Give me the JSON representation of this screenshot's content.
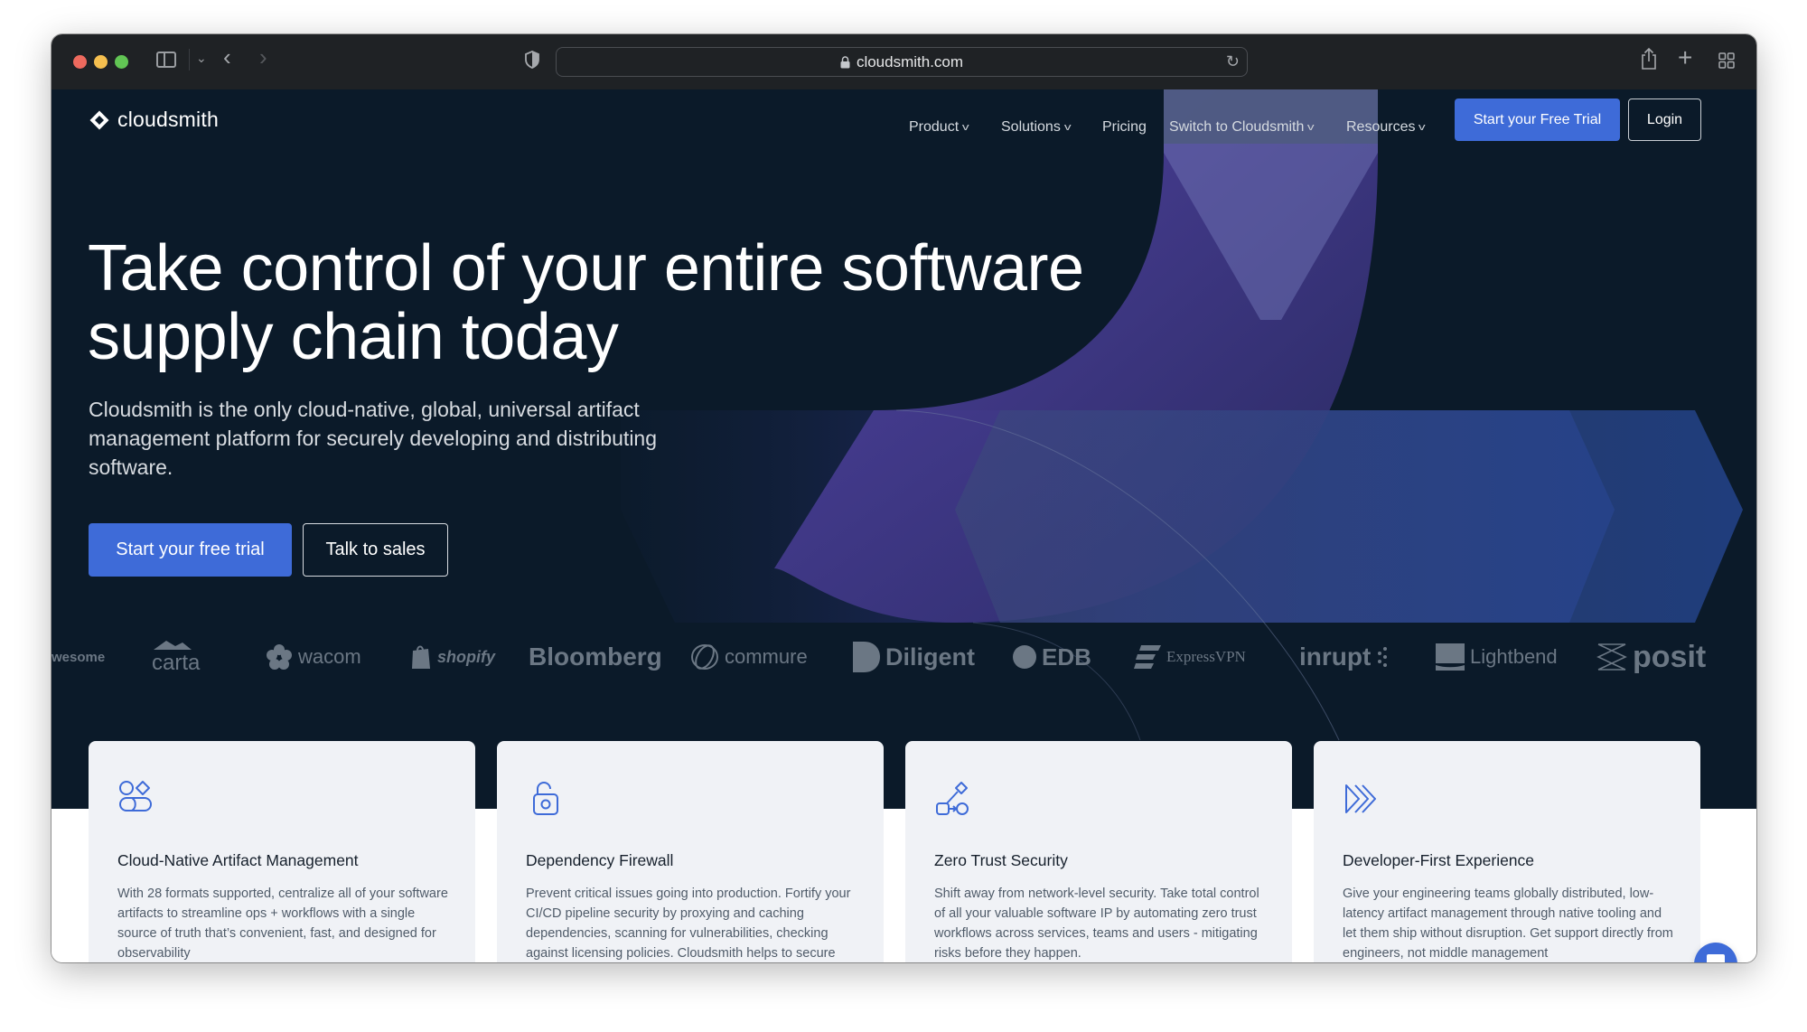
{
  "browser": {
    "url": "cloudsmith.com",
    "icons": {
      "close": "traffic-red",
      "minimize": "traffic-yellow",
      "maximize": "traffic-green",
      "sidebar": "sidebar-icon",
      "tab_menu": "chevron-down-icon",
      "back": "chevron-left-icon",
      "forward": "chevron-right-icon",
      "privacy": "shield-icon",
      "lock": "lock-icon",
      "reload": "reload-icon",
      "share": "share-icon",
      "new_tab": "plus-icon",
      "tab_overview": "grid-icon"
    },
    "glyphs": {
      "chevron_down": "⌄",
      "back": "‹",
      "forward": "›",
      "reload": "↻",
      "plus": "+"
    }
  },
  "nav": {
    "logo_text": "cloudsmith",
    "items": [
      {
        "label": "Product",
        "has_dropdown": true
      },
      {
        "label": "Solutions",
        "has_dropdown": true
      },
      {
        "label": "Pricing",
        "has_dropdown": false
      },
      {
        "label": "Switch to Cloudsmith",
        "has_dropdown": true
      },
      {
        "label": "Resources",
        "has_dropdown": true
      }
    ],
    "dropdown_glyph": "v",
    "cta_label": "Start your Free Trial",
    "login_label": "Login"
  },
  "hero": {
    "headline_line1": "Take control of your entire software",
    "headline_line2": "supply chain today",
    "subtext": "Cloudsmith is the only cloud-native, global, universal artifact management platform for securely developing and distributing software.",
    "primary_cta": "Start your free trial",
    "secondary_cta": "Talk to sales"
  },
  "customer_logos": [
    "wesome",
    "carta",
    "wacom",
    "shopify",
    "Bloomberg",
    "commure",
    "Diligent",
    "EDB",
    "ExpressVPN",
    "inrupt",
    "Lightbend",
    "posit"
  ],
  "features": [
    {
      "icon": "shapes-icon",
      "title": "Cloud-Native Artifact Management",
      "description": "With 28 formats supported, centralize all of your software artifacts to streamline ops + workflows with a single source of truth that’s convenient, fast, and designed for observability"
    },
    {
      "icon": "unlock-icon",
      "title": "Dependency Firewall",
      "description": "Prevent critical issues going into production. Fortify your CI/CD pipeline security by proxying and caching dependencies, scanning for vulnerabilities, checking against licensing policies. Cloudsmith helps to secure your valuable IP."
    },
    {
      "icon": "workflow-icon",
      "title": "Zero Trust Security",
      "description": "Shift away from network-level security. Take total control of all your valuable software IP by automating zero trust workflows across services, teams and users - mitigating risks before they happen."
    },
    {
      "icon": "fast-forward-icon",
      "title": "Developer-First Experience",
      "description": "Give your engineering teams globally distributed, low-latency artifact management through native tooling and let them ship without disruption. Get support directly from engineers, not middle management"
    }
  ],
  "chat_widget": {
    "icon": "chat-icon"
  },
  "colors": {
    "brand_blue": "#3e6bd8",
    "hero_bg": "#0b1a29",
    "card_bg": "#f0f2f6",
    "logo_gray": "#6b7784",
    "toolbar_bg": "#1f2225"
  }
}
